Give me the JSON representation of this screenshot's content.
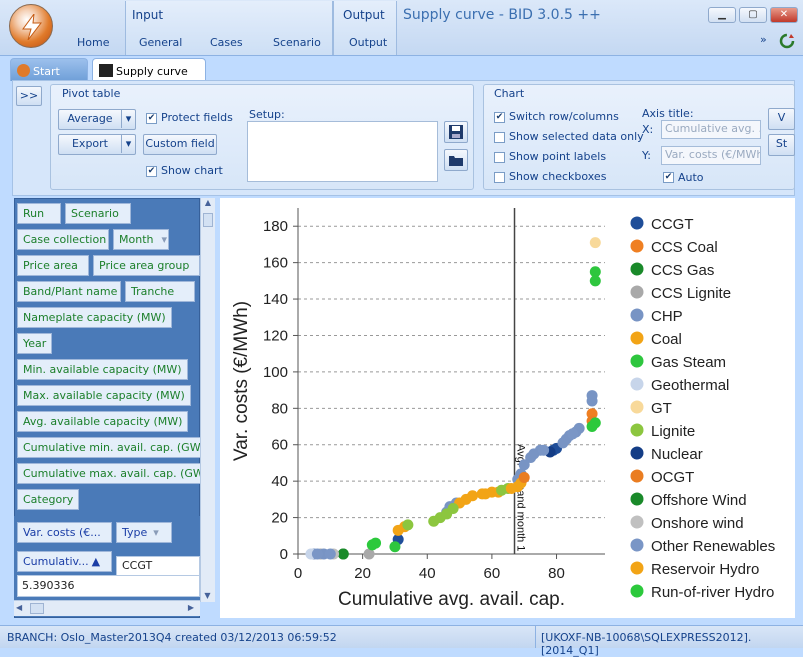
{
  "window": {
    "title": "Supply curve - BID 3.0.5 ++"
  },
  "ribbon": {
    "groups": [
      {
        "label": "Input"
      },
      {
        "label": "Output"
      }
    ],
    "tabs": [
      "Home",
      "General",
      "Cases",
      "Scenario",
      "Output"
    ]
  },
  "doc_tabs": {
    "start": "Start",
    "supply": "Supply curve"
  },
  "pivot": {
    "title": "Pivot table",
    "expand": ">>",
    "average": "Average",
    "export": "Export",
    "custom_field": "Custom field",
    "protect_fields": "Protect fields",
    "show_chart": "Show chart",
    "setup_label": "Setup:"
  },
  "chartbox": {
    "title": "Chart",
    "switch_row": "Switch row/columns",
    "show_selected": "Show selected data only",
    "show_point_labels": "Show point labels",
    "show_checkboxes": "Show checkboxes",
    "axis_title": "Axis title:",
    "x_label": "X:",
    "y_label": "Y:",
    "x_value": "Cumulative avg. ...",
    "y_value": "Var. costs (€/MWh)",
    "auto": "Auto",
    "btn1": "V",
    "btn2": "St"
  },
  "fields": [
    [
      "Run",
      "Scenario"
    ],
    [
      "Case collection",
      "Month"
    ],
    [
      "Price area",
      "Price area group"
    ],
    [
      "Band/Plant name",
      "Tranche"
    ],
    [
      "Nameplate capacity (MW)"
    ],
    [
      "Year"
    ],
    [
      "Min. available capacity (MW)"
    ],
    [
      "Max. available capacity (MW)"
    ],
    [
      "Avg. available capacity (MW)"
    ],
    [
      "Cumulative min. avail. cap. (GW)"
    ],
    [
      "Cumulative max. avail. cap. (GW)"
    ],
    [
      "Category"
    ]
  ],
  "data_fields": {
    "var_costs": "Var. costs (€...",
    "type": "Type",
    "cumulative": "Cumulativ...",
    "col_header": "CCGT",
    "row_value": "5.390336"
  },
  "status": {
    "left": "BRANCH: Oslo_Master2013Q4 created 03/12/2013 06:59:52",
    "right": "[UKOXF-NB-10068\\SQLEXPRESS2012].[2014_Q1]"
  },
  "chart_data": {
    "type": "scatter",
    "xlabel": "Cumulative avg. avail. cap.",
    "ylabel": "Var. costs (€/MWh)",
    "xlim": [
      0,
      95
    ],
    "ylim": [
      0,
      190
    ],
    "xticks": [
      0,
      20,
      40,
      60,
      80
    ],
    "yticks": [
      0,
      20,
      40,
      60,
      80,
      100,
      120,
      140,
      160,
      180
    ],
    "grid": "horizontal dashed",
    "legend_position": "right",
    "annotation": {
      "x": 67,
      "text": "Avg. demand month 1"
    },
    "series": [
      {
        "name": "CCGT",
        "color": "#1f4e99",
        "points": [
          [
            31,
            8
          ],
          [
            79,
            57
          ],
          [
            80,
            58
          ]
        ]
      },
      {
        "name": "CCS Coal",
        "color": "#ef7f22",
        "points": [
          [
            91,
            77
          ]
        ]
      },
      {
        "name": "CCS Gas",
        "color": "#1a8a2a",
        "points": [
          [
            14,
            0
          ]
        ]
      },
      {
        "name": "CCS Lignite",
        "color": "#a9a9a9",
        "points": [
          [
            7,
            0
          ],
          [
            22,
            0
          ]
        ]
      },
      {
        "name": "CHP",
        "color": "#7894c4",
        "points": [
          [
            5,
            0
          ],
          [
            8,
            0
          ],
          [
            46,
            23
          ],
          [
            47,
            26
          ],
          [
            49,
            28
          ],
          [
            68,
            41
          ],
          [
            69,
            44
          ],
          [
            70,
            49
          ],
          [
            72,
            53
          ],
          [
            73,
            55
          ],
          [
            75,
            57
          ],
          [
            82,
            61
          ],
          [
            83,
            63
          ],
          [
            84,
            65
          ],
          [
            86,
            67
          ],
          [
            87,
            69
          ],
          [
            91,
            84
          ],
          [
            91,
            87
          ]
        ]
      },
      {
        "name": "Coal",
        "color": "#f2a416",
        "points": [
          [
            31,
            13
          ],
          [
            33,
            15
          ],
          [
            50,
            28
          ],
          [
            52,
            30
          ],
          [
            54,
            32
          ],
          [
            57,
            33
          ],
          [
            60,
            34
          ],
          [
            62,
            34
          ],
          [
            68,
            37
          ],
          [
            69,
            39
          ]
        ]
      },
      {
        "name": "Gas Steam",
        "color": "#2ec63e",
        "points": [
          [
            30,
            4
          ],
          [
            92,
            150
          ],
          [
            92,
            155
          ]
        ]
      },
      {
        "name": "Geothermal",
        "color": "#c7d5ea",
        "points": [
          [
            4,
            0
          ]
        ]
      },
      {
        "name": "GT",
        "color": "#f8d99a",
        "points": [
          [
            92,
            171
          ]
        ]
      },
      {
        "name": "Lignite",
        "color": "#8cc63f",
        "points": [
          [
            34,
            16
          ],
          [
            42,
            18
          ],
          [
            44,
            20
          ],
          [
            46,
            22
          ],
          [
            48,
            25
          ],
          [
            63,
            35
          ],
          [
            65,
            36
          ]
        ]
      },
      {
        "name": "Nuclear",
        "color": "#143d86",
        "points": [
          [
            78,
            56
          ]
        ]
      },
      {
        "name": "OCGT",
        "color": "#ea7d21",
        "points": [
          [
            70,
            42
          ],
          [
            91,
            73
          ]
        ]
      },
      {
        "name": "Offshore Wind",
        "color": "#1a8a2a",
        "points": [
          [
            14,
            0
          ]
        ]
      },
      {
        "name": "Onshore wind",
        "color": "#c0c0c0",
        "points": [
          [
            11,
            0
          ]
        ]
      },
      {
        "name": "Other Renewables",
        "color": "#7a96c6",
        "points": [
          [
            6,
            0
          ],
          [
            10,
            0
          ],
          [
            76,
            57
          ],
          [
            85,
            66
          ]
        ]
      },
      {
        "name": "Reservoir Hydro",
        "color": "#f2a416",
        "points": [
          [
            58,
            33
          ],
          [
            66,
            36
          ]
        ]
      },
      {
        "name": "Run-of-river Hydro",
        "color": "#2cc93c",
        "points": [
          [
            23,
            5
          ],
          [
            24,
            6
          ],
          [
            91,
            70
          ],
          [
            92,
            72
          ]
        ]
      }
    ]
  }
}
